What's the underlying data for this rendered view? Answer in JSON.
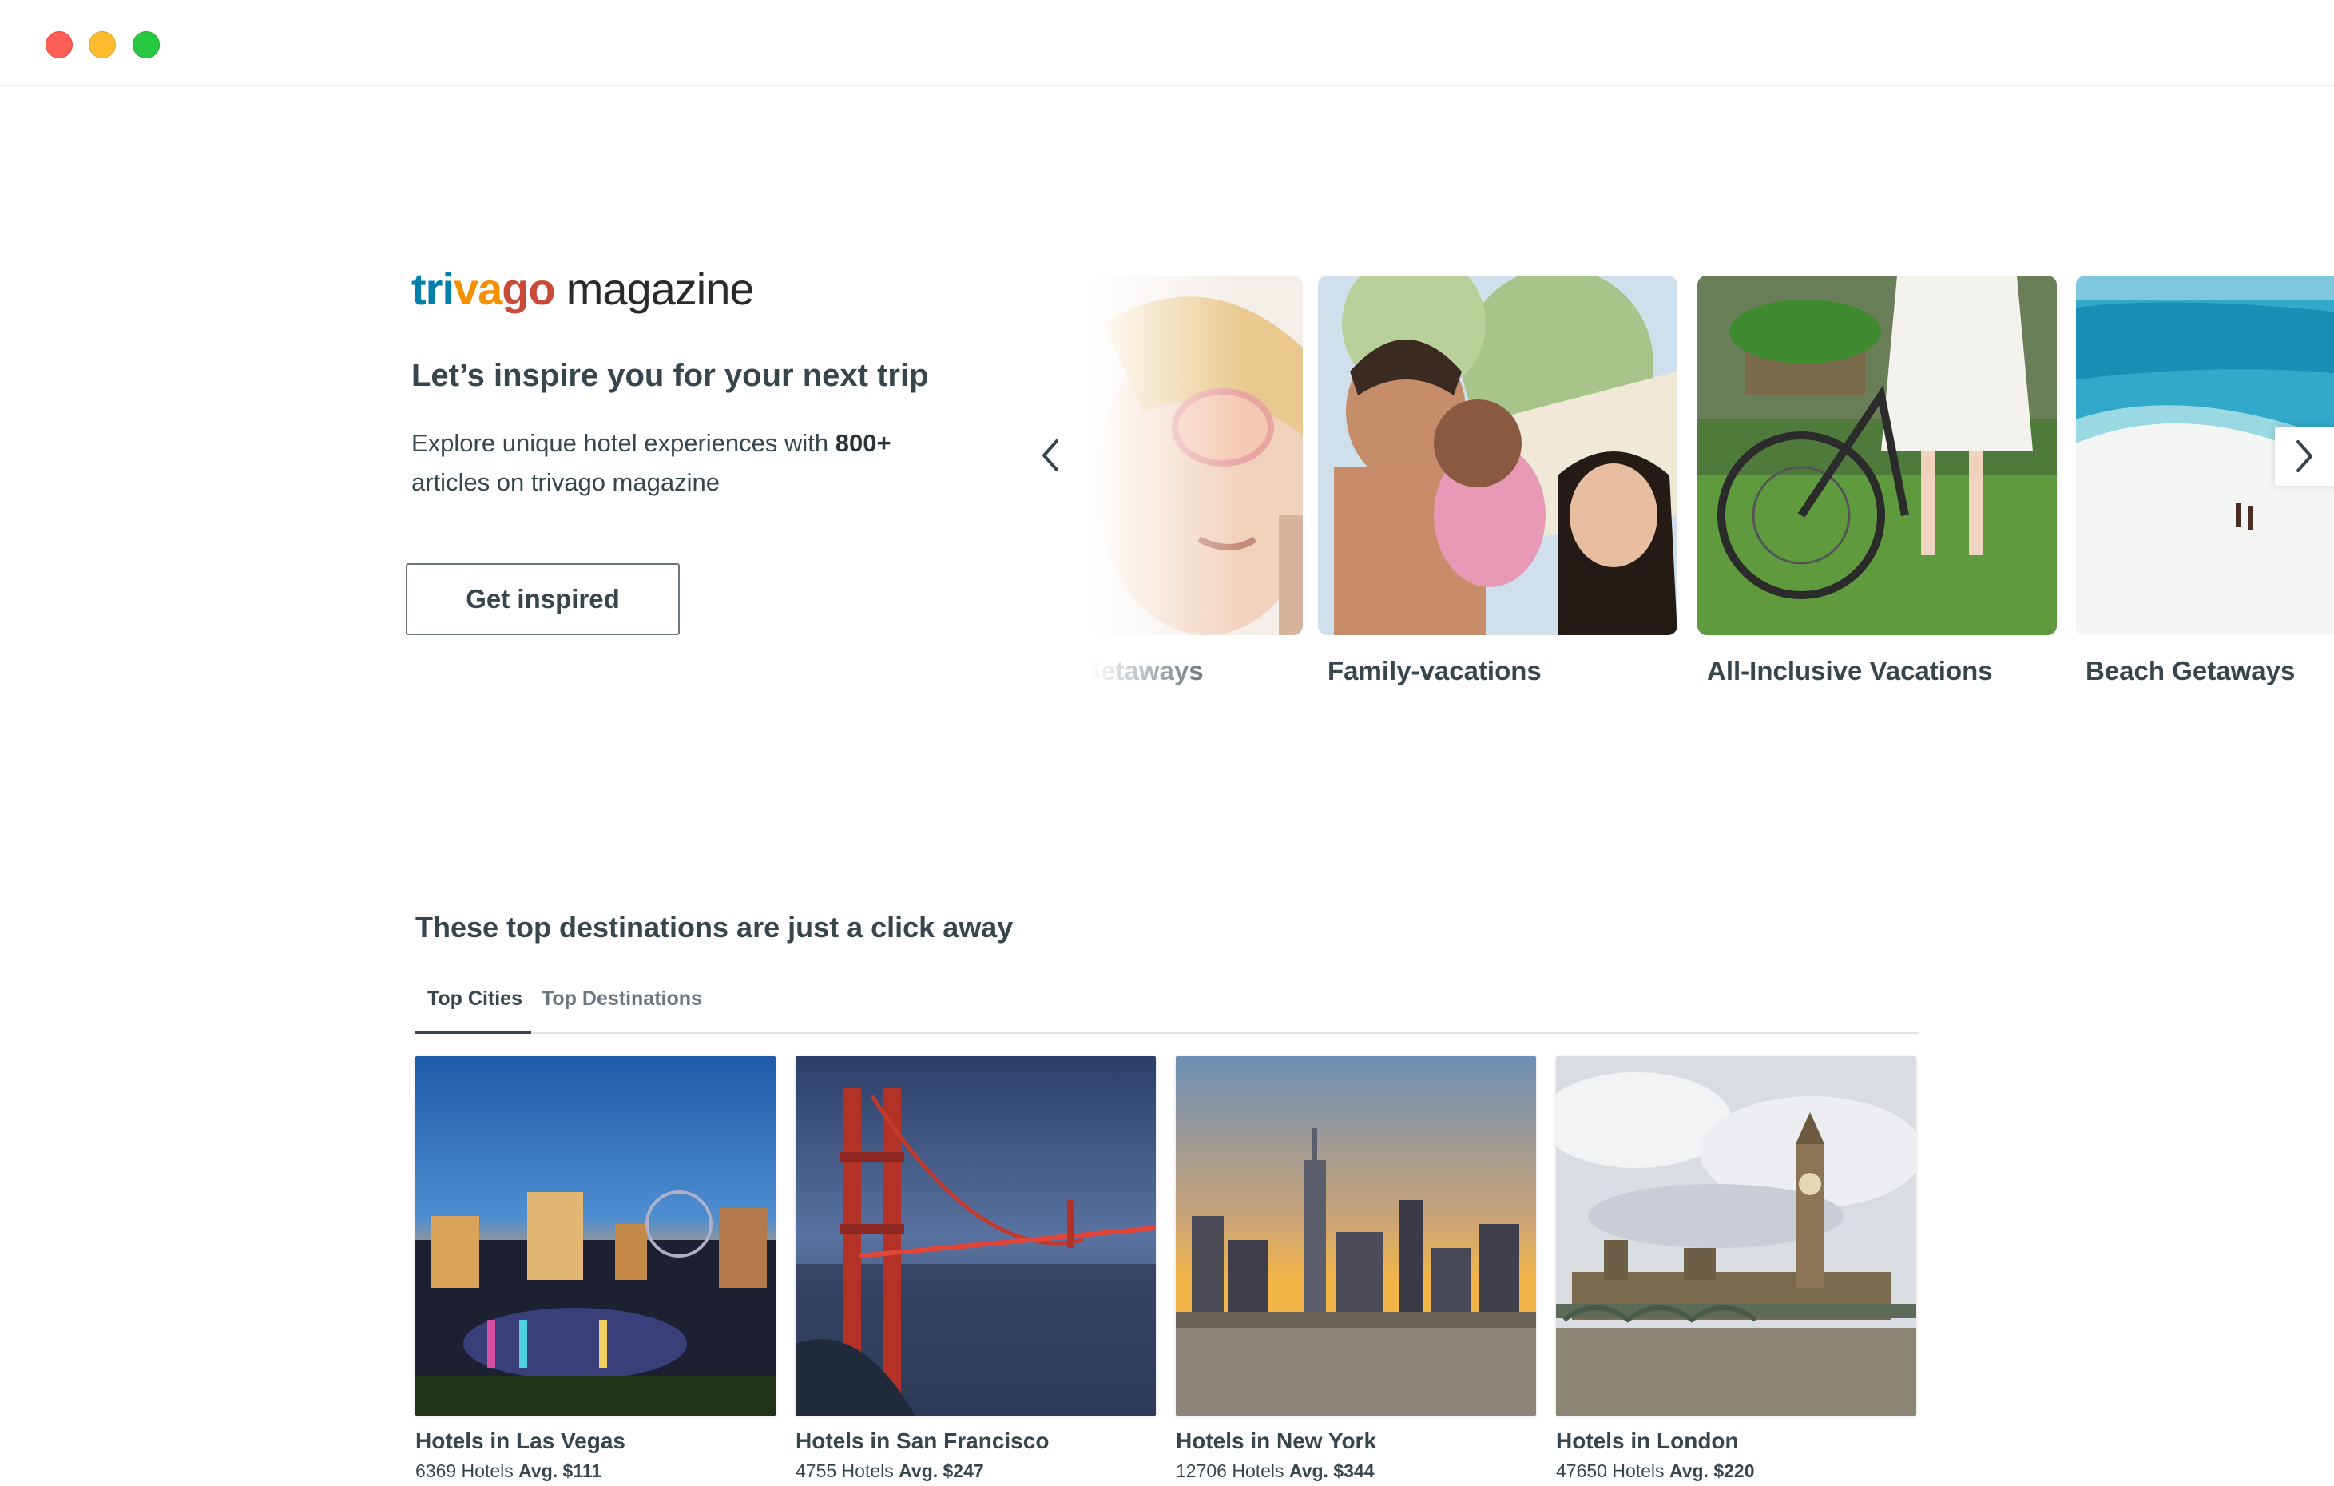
{
  "window": {
    "controls": [
      "close",
      "minimize",
      "maximize"
    ]
  },
  "magazine": {
    "logo": {
      "part1": "tri",
      "part2": "va",
      "part3": "go",
      "part4": "magazine"
    },
    "headline": "Let’s inspire you for your next trip",
    "intro_prefix": "Explore unique hotel experiences with ",
    "intro_bold": "800+",
    "intro_suffix": " articles on trivago magazine",
    "button_label": "Get inspired"
  },
  "carousel": {
    "prev_icon": "chevron-left-icon",
    "next_icon": "chevron-right-icon",
    "items": [
      {
        "label": "Romantic Getaways"
      },
      {
        "label": "Family-vacations"
      },
      {
        "label": "All-Inclusive Vacations"
      },
      {
        "label": "Beach Getaways"
      }
    ]
  },
  "destinations": {
    "title": "These top destinations are just a click away",
    "tabs": [
      {
        "label": "Top Cities"
      },
      {
        "label": "Top Destinations"
      }
    ],
    "active_tab": "Top Cities",
    "cities": [
      {
        "name": "Hotels in Las Vegas",
        "count": "6369 Hotels",
        "avg": "Avg. $111"
      },
      {
        "name": "Hotels in San Francisco",
        "count": "4755 Hotels",
        "avg": "Avg. $247"
      },
      {
        "name": "Hotels in New York",
        "count": "12706 Hotels",
        "avg": "Avg. $344"
      },
      {
        "name": "Hotels in London",
        "count": "47650 Hotels",
        "avg": "Avg. $220"
      }
    ]
  },
  "colors": {
    "text": "#37454d",
    "logo_blue": "#007fad",
    "logo_orange": "#f48f00",
    "logo_red": "#c94a38"
  }
}
